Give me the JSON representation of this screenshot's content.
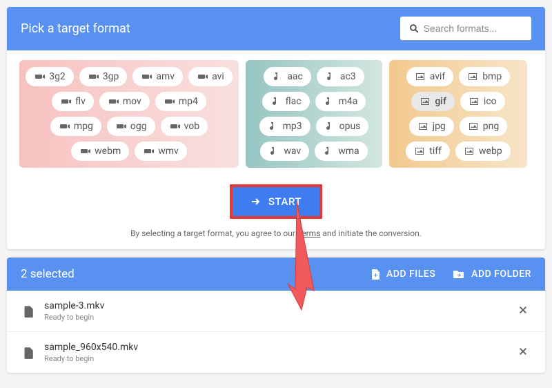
{
  "header": {
    "title": "Pick a target format",
    "search_placeholder": "Search formats..."
  },
  "formats": {
    "video": [
      "3g2",
      "3gp",
      "amv",
      "avi",
      "flv",
      "mov",
      "mp4",
      "mpg",
      "ogg",
      "vob",
      "webm",
      "wmv"
    ],
    "audio": [
      "aac",
      "ac3",
      "flac",
      "m4a",
      "mp3",
      "opus",
      "wav",
      "wma"
    ],
    "image": [
      "avif",
      "bmp",
      "gif",
      "ico",
      "jpg",
      "png",
      "tiff",
      "webp"
    ],
    "selected": "gif"
  },
  "start_label": "START",
  "terms": {
    "prefix": "By selecting a target format, you agree to our ",
    "link": "Terms",
    "suffix": " and initiate the conversion."
  },
  "files_header": {
    "selected_text": "2 selected",
    "add_files": "ADD FILES",
    "add_folder": "ADD FOLDER"
  },
  "files": [
    {
      "name": "sample-3.mkv",
      "status": "Ready to begin"
    },
    {
      "name": "sample_960x540.mkv",
      "status": "Ready to begin"
    }
  ]
}
